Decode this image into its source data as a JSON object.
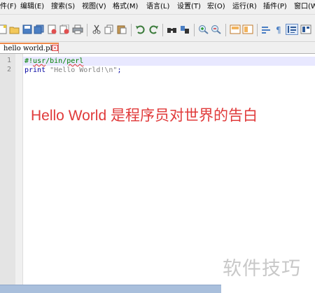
{
  "menu": {
    "items": [
      "件(F)",
      "编辑(E)",
      "搜索(S)",
      "视图(V)",
      "格式(M)",
      "语言(L)",
      "设置(T)",
      "宏(O)",
      "运行(R)",
      "插件(P)",
      "窗口(W"
    ]
  },
  "toolbar": {
    "icons": [
      "new-file-icon",
      "open-file-icon",
      "save-icon",
      "save-all-icon",
      "close-icon",
      "close-all-icon",
      "print-icon",
      "cut-icon",
      "copy-icon",
      "paste-icon",
      "undo-icon",
      "redo-icon",
      "find-icon",
      "replace-icon",
      "zoom-in-icon",
      "zoom-out-icon",
      "sync-v-icon",
      "sync-h-icon",
      "word-wrap-icon",
      "show-all-chars-icon",
      "indent-guide-icon",
      "user-lang-icon"
    ]
  },
  "tab": {
    "label": "hello world.pl",
    "close_glyph": "×"
  },
  "editor": {
    "line_numbers": [
      "1",
      "2"
    ],
    "line1": {
      "prefix": "#!",
      "squiggly": "usr",
      "middle": "/bin/",
      "squiggly2": "perl"
    },
    "line2": {
      "keyword": "print ",
      "string": "\"Hello World!\\n\"",
      "end": ";"
    }
  },
  "overlay_text": "Hello World 是程序员对世界的告白",
  "watermark": "软件技巧",
  "colors": {
    "overlay": "#e03a3a",
    "comment": "#008000",
    "keyword": "#0000a0",
    "tab_accent": "#f08a4b"
  }
}
